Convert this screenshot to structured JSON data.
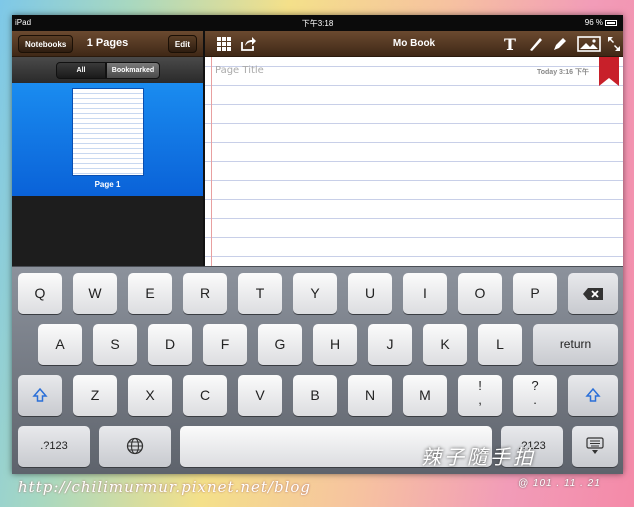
{
  "status": {
    "device": "iPad",
    "time": "下午3:18",
    "battery": "96 %"
  },
  "sidebar": {
    "notebooks_label": "Notebooks",
    "title": "1 Pages",
    "edit_label": "Edit",
    "segments": [
      {
        "label": "All"
      },
      {
        "label": "Bookmarked"
      }
    ],
    "pages": [
      {
        "label": "Page 1"
      }
    ]
  },
  "toolbar": {
    "title": "Mo Book",
    "icons": [
      "grid-icon",
      "share-icon",
      "text-icon",
      "pen-icon",
      "highlighter-icon",
      "image-icon",
      "fullscreen-icon"
    ]
  },
  "page": {
    "title_placeholder": "Page Title",
    "date": "Today 3:16 下午"
  },
  "keyboard": {
    "row1": [
      "Q",
      "W",
      "E",
      "R",
      "T",
      "Y",
      "U",
      "I",
      "O",
      "P"
    ],
    "row2": [
      "A",
      "S",
      "D",
      "F",
      "G",
      "H",
      "J",
      "K",
      "L"
    ],
    "row2_return": "return",
    "row3": [
      "Z",
      "X",
      "C",
      "V",
      "B",
      "N",
      "M"
    ],
    "row3_punct1_top": "!",
    "row3_punct1_bottom": ",",
    "row3_punct2_top": "?",
    "row3_punct2_bottom": ".",
    "numbers_label": ".?123"
  },
  "overlay": {
    "url": "http://chilimurmur.pixnet.net/blog",
    "signature": "辣子隨手拍",
    "date": "@ 101 . 11 . 21"
  },
  "colors": {
    "accent_blue": "#0a62d8",
    "bookmark_red": "#c8202a",
    "toolbar_brown": "#5a3e26"
  }
}
